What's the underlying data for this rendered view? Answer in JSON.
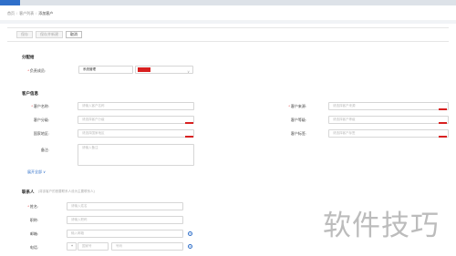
{
  "breadcrumb": [
    "首页",
    "客户列表",
    "添加客户"
  ],
  "toolbar": {
    "buttons": [
      "保存",
      "保存并新建",
      "取消"
    ]
  },
  "sections": {
    "allocation": "分配给",
    "customer_info": "客户信息",
    "contacts": "联系人"
  },
  "allocation": {
    "label": "负责成员:",
    "value": "系统管理"
  },
  "customer": {
    "name_label": "客户名称:",
    "name_placeholder": "请输入客户名称",
    "category_label": "客户分级:",
    "category_placeholder": "请选择客户分级",
    "region_label": "国家地区:",
    "region_placeholder": "请选择国家地区",
    "note_label": "备注:",
    "note_placeholder": "请输入备注",
    "source_label": "客户来源:",
    "source_placeholder": "请选择客户来源",
    "level_label": "客户等级:",
    "level_placeholder": "请选择客户等级",
    "tag_label": "客户标签:",
    "tag_placeholder": "请选择客户标签",
    "expand_link": "展开全部",
    "expand_glyph": "∨"
  },
  "contact": {
    "hint": "(将该客户的首要联系人设为主要联系人)",
    "name_label": "姓名:",
    "name_placeholder": "请输入姓名",
    "title_label": "职称:",
    "title_placeholder": "请输入职称",
    "email_label": "邮箱:",
    "email_placeholder": "输入邮箱",
    "phone_label": "电话:",
    "phone_code": "+",
    "phone_country_placeholder": "国家号",
    "phone_placeholder": "号码"
  },
  "watermark": "软件技巧",
  "colors": {
    "accent": "#2f6fc9",
    "required": "#e02b2b",
    "redact": "#d82020"
  }
}
